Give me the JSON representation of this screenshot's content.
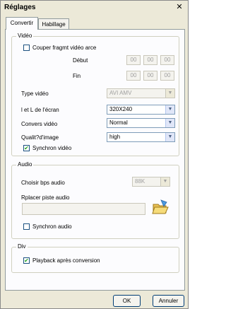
{
  "window": {
    "title": "Réglages"
  },
  "tabs": [
    {
      "label": "Convertir"
    },
    {
      "label": "Habillage"
    }
  ],
  "video": {
    "group_label": "Vidéo",
    "cut_label": "Couper fragmt vidéo arce",
    "start_label": "Début",
    "end_label": "Fin",
    "start": [
      "00",
      "00",
      "00"
    ],
    "end": [
      "00",
      "00",
      "00"
    ],
    "type_label": "Type vidéo",
    "type_value": "AVI AMV",
    "size_label": "l et L de l'écran",
    "size_value": "320X240",
    "convert_label": "Convers vidéo",
    "convert_value": "Normal",
    "quality_label": "Qualit?d'image",
    "quality_value": "high",
    "sync_label": "Synchron vidéo"
  },
  "audio": {
    "group_label": "Audio",
    "bps_label": "Choisir bps audio",
    "bps_value": "88K",
    "replace_label": "Rplacer piste audio",
    "replace_value": "",
    "sync_label": "Synchron audio"
  },
  "div": {
    "group_label": "Div",
    "playback_label": "Playback après conversion"
  },
  "buttons": {
    "ok": "OK",
    "cancel": "Annuler"
  },
  "colors": {
    "accent": "#21a121",
    "face": "#ece9d8"
  },
  "icons": {
    "close": "close-icon",
    "folder": "folder-open-icon",
    "dropdown": "chevron-down-icon"
  }
}
